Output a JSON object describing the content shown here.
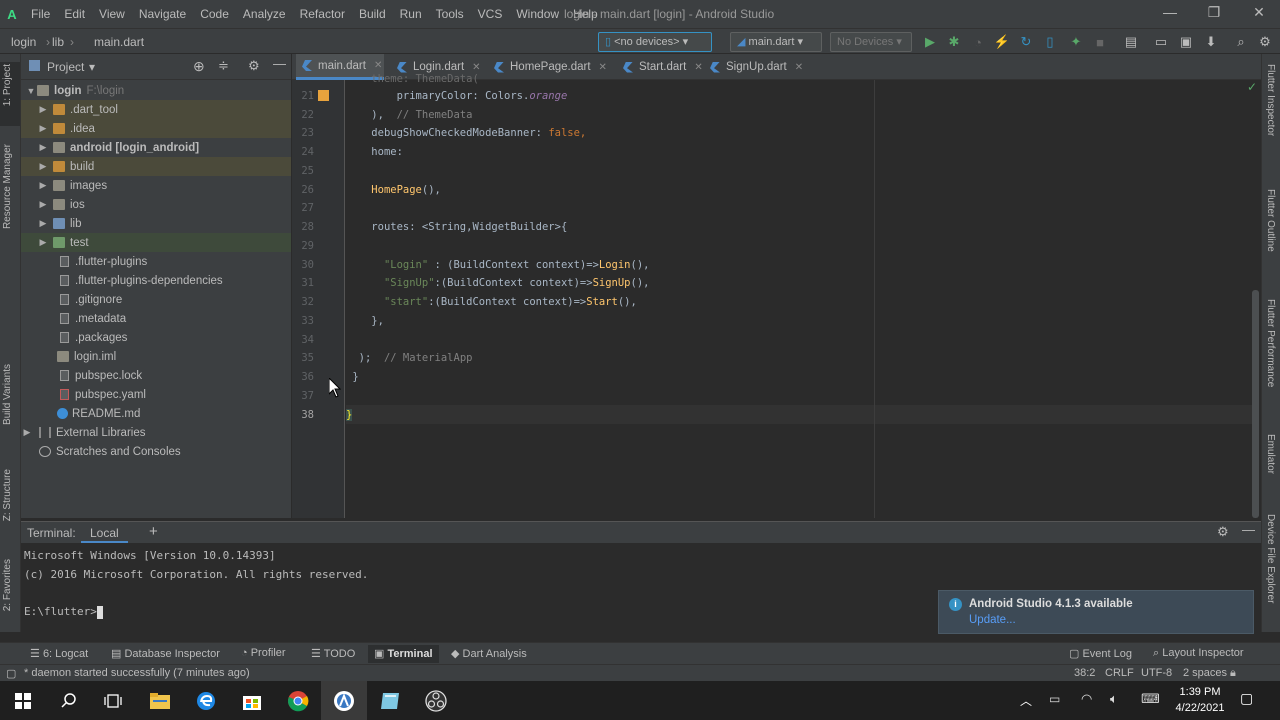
{
  "window": {
    "title": "login - main.dart [login] - Android Studio",
    "menu": [
      "File",
      "Edit",
      "View",
      "Navigate",
      "Code",
      "Analyze",
      "Refactor",
      "Build",
      "Run",
      "Tools",
      "VCS",
      "Window",
      "Help"
    ],
    "controls": {
      "minimize": "—",
      "maximize": "❐",
      "close": "✕"
    }
  },
  "navbar": {
    "breadcrumbs": [
      "login",
      "lib",
      "main.dart"
    ],
    "device_dropdown": "<no devices>",
    "run_config": "main.dart",
    "device_list": "No Devices"
  },
  "project_panel": {
    "header": "Project",
    "tree": [
      {
        "label": "login",
        "suffix": "F:\\login",
        "level": 0,
        "expanded": true,
        "kind": "folder"
      },
      {
        "label": ".dart_tool",
        "level": 1,
        "kind": "folder-orange",
        "hl": "orange"
      },
      {
        "label": ".idea",
        "level": 1,
        "kind": "folder-orange",
        "hl": "orange"
      },
      {
        "label": "android [login_android]",
        "level": 1,
        "kind": "folder",
        "bold": true
      },
      {
        "label": "build",
        "level": 1,
        "kind": "folder-orange",
        "hl": "orange"
      },
      {
        "label": "images",
        "level": 1,
        "kind": "folder"
      },
      {
        "label": "ios",
        "level": 1,
        "kind": "folder"
      },
      {
        "label": "lib",
        "level": 1,
        "kind": "folder-blue"
      },
      {
        "label": "test",
        "level": 1,
        "kind": "folder-green",
        "hl": "green"
      },
      {
        "label": ".flutter-plugins",
        "level": 2,
        "kind": "file"
      },
      {
        "label": ".flutter-plugins-dependencies",
        "level": 2,
        "kind": "file"
      },
      {
        "label": ".gitignore",
        "level": 2,
        "kind": "file"
      },
      {
        "label": ".metadata",
        "level": 2,
        "kind": "file"
      },
      {
        "label": ".packages",
        "level": 2,
        "kind": "file"
      },
      {
        "label": "login.iml",
        "level": 2,
        "kind": "file"
      },
      {
        "label": "pubspec.lock",
        "level": 2,
        "kind": "file"
      },
      {
        "label": "pubspec.yaml",
        "level": 2,
        "kind": "file"
      },
      {
        "label": "README.md",
        "level": 2,
        "kind": "file"
      },
      {
        "label": "External Libraries",
        "level": 0,
        "kind": "lib"
      },
      {
        "label": "Scratches and Consoles",
        "level": 0,
        "kind": "scratch"
      }
    ]
  },
  "tabs": [
    {
      "label": "main.dart",
      "active": true
    },
    {
      "label": "Login.dart"
    },
    {
      "label": "HomePage.dart"
    },
    {
      "label": "Start.dart"
    },
    {
      "label": "SignUp.dart"
    }
  ],
  "editor": {
    "line_numbers": [
      "21",
      "22",
      "23",
      "24",
      "25",
      "26",
      "27",
      "28",
      "29",
      "30",
      "31",
      "32",
      "33",
      "34",
      "35",
      "36",
      "37",
      "38"
    ],
    "current_line": "38"
  },
  "left_stripe": [
    "1: Project",
    "Resource Manager",
    "Build Variants",
    "Z: Structure",
    "2: Favorites"
  ],
  "right_stripe": [
    "Flutter Inspector",
    "Flutter Outline",
    "Flutter Performance",
    "Emulator",
    "Device File Explorer"
  ],
  "terminal": {
    "label": "Terminal:",
    "tab": "Local",
    "add": "+",
    "lines": [
      "Microsoft Windows [Version 10.0.14393]",
      "(c) 2016 Microsoft Corporation. All rights reserved.",
      "",
      "E:\\flutter>"
    ]
  },
  "notification": {
    "title": "Android Studio 4.1.3 available",
    "link": "Update..."
  },
  "bottom_tabs": [
    "6: Logcat",
    "Database Inspector",
    "Profiler",
    "TODO",
    "Terminal",
    "Dart Analysis"
  ],
  "bottom_right_tabs": [
    "Event Log",
    "Layout Inspector"
  ],
  "status": {
    "message": "* daemon started successfully (7 minutes ago)",
    "position": "38:2",
    "line_sep": "CRLF",
    "encoding": "UTF-8",
    "indent": "2 spaces"
  },
  "taskbar": {
    "time": "1:39 PM",
    "date": "4/22/2021"
  }
}
